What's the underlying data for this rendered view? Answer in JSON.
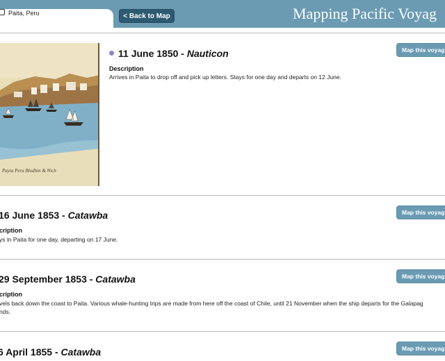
{
  "header": {
    "location": "Paita, Peru",
    "back_label": "< Back to Map",
    "site_title": "Mapping Pacific Voyag"
  },
  "entries": [
    {
      "date": "11 June 1850 - ",
      "ship": "Nauticon",
      "desc_label": "Description",
      "desc_text": "Arrives in Paita to drop off and pick up letters. Stays for one day and departs on 12 June.",
      "map_label": "Map this voyag"
    },
    {
      "date": "16 June 1853 - ",
      "ship": "Catawba",
      "desc_label": "cription",
      "desc_text": "ys in Paita for one day, departing on 17 June.",
      "map_label": "Map this voyag"
    },
    {
      "date": "29 September 1853 - ",
      "ship": "Catawba",
      "desc_label": "cription",
      "desc_text": "vels back down the coast to Paita. Various whale-hunting trips are made from here off the coast of Chile, until 21 November when the ship departs for the Galapag",
      "desc_text2": "nds.",
      "map_label": "Map this voyag"
    },
    {
      "date": "6 April 1855 - ",
      "ship": "Catawba",
      "map_label": "Map this voyag"
    }
  ],
  "painting": {
    "caption": "Payta   Peru         Blodhin   &   Nich"
  },
  "colors": {
    "header_bg": "#6a9bb3",
    "button_dark": "#2d5a73",
    "bullet": "#8a86c6"
  }
}
